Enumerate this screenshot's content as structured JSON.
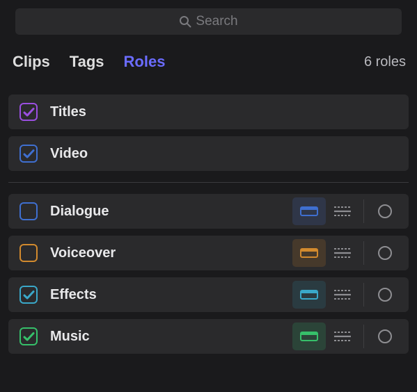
{
  "search": {
    "placeholder": "Search"
  },
  "tabs": {
    "clips": "Clips",
    "tags": "Tags",
    "roles": "Roles",
    "active": "roles"
  },
  "count_label": "6 roles",
  "colors": {
    "purple": "#9a4fe0",
    "blue": "#3f6fd0",
    "orange": "#d28a2e",
    "cyan": "#3aa8c9",
    "green": "#36c06a",
    "line": "#8e8e92"
  },
  "video_roles": [
    {
      "id": "titles",
      "label": "Titles",
      "color": "purple",
      "checked": true
    },
    {
      "id": "video",
      "label": "Video",
      "color": "blue",
      "checked": true
    }
  ],
  "audio_roles": [
    {
      "id": "dialogue",
      "label": "Dialogue",
      "color": "blue",
      "checked": false,
      "lane_tint": "blue"
    },
    {
      "id": "voiceover",
      "label": "Voiceover",
      "color": "orange",
      "checked": false,
      "lane_tint": "orange"
    },
    {
      "id": "effects",
      "label": "Effects",
      "color": "cyan",
      "checked": true,
      "lane_tint": "cyan"
    },
    {
      "id": "music",
      "label": "Music",
      "color": "green",
      "checked": true,
      "lane_tint": "green"
    }
  ]
}
